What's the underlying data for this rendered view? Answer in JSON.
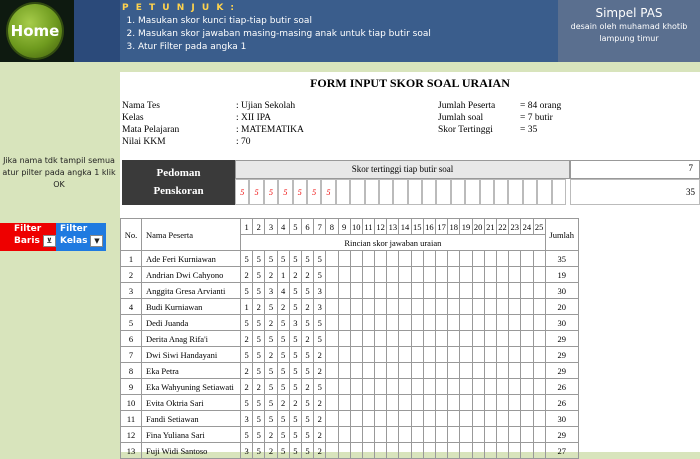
{
  "header": {
    "home_label": "Home",
    "instructions_title": "P E T U N J U K :",
    "instructions": [
      "Masukan skor kunci tiap-tiap butir soal",
      "Masukan skor jawaban masing-masing anak untuk tiap butir soal",
      "Atur Filter pada angka 1"
    ],
    "brand_title": "Simpel PAS",
    "brand_sub1": "desain oleh muhamad khotib",
    "brand_sub2": "lampung timur"
  },
  "sidebar": {
    "note": "Jika nama tdk tampil semua atur pilter pada angka 1 klik OK",
    "filter_baris_l1": "Filter",
    "filter_baris_l2": "Baris",
    "filter_kelas_l1": "Filter",
    "filter_kelas_l2": "Kelas"
  },
  "form": {
    "title": "FORM INPUT SKOR SOAL URAIAN",
    "left": [
      {
        "k": "Nama Tes",
        "v": ":  Ujian Sekolah"
      },
      {
        "k": "Kelas",
        "v": ":  XII IPA"
      },
      {
        "k": "Mata Pelajaran",
        "v": ":  MATEMATIKA"
      },
      {
        "k": "Nilai KKM",
        "v": ":  70"
      }
    ],
    "right": [
      {
        "k": "Jumlah Peserta",
        "v": "=   84 orang"
      },
      {
        "k": "Jumlah soal",
        "v": "=   7 butir"
      },
      {
        "k": "Skor Tertinggi",
        "v": "=   35"
      }
    ],
    "pedoman_l1": "Pedoman",
    "pedoman_l2": "Penskoran",
    "skor_header": "Skor tertinggi tiap butir soal",
    "max_scores": [
      "5",
      "5",
      "5",
      "5",
      "5",
      "5",
      "5"
    ],
    "soal_count": "7",
    "total_max": "35"
  },
  "table": {
    "col_no": "No.",
    "col_name": "Nama Peserta",
    "col_total": "Jumlah",
    "sub_header": "Rincian skor jawaban uraian",
    "item_numbers": [
      "1",
      "2",
      "3",
      "4",
      "5",
      "6",
      "7",
      "8",
      "9",
      "10",
      "11",
      "12",
      "13",
      "14",
      "15",
      "16",
      "17",
      "18",
      "19",
      "20",
      "21",
      "22",
      "23",
      "24",
      "25"
    ],
    "rows": [
      {
        "no": "1",
        "name": "Ade Feri Kurniawan",
        "s": [
          "5",
          "5",
          "5",
          "5",
          "5",
          "5",
          "5"
        ],
        "total": "35"
      },
      {
        "no": "2",
        "name": "Andrian Dwi Cahyono",
        "s": [
          "2",
          "5",
          "2",
          "1",
          "2",
          "2",
          "5"
        ],
        "total": "19"
      },
      {
        "no": "3",
        "name": "Anggita Gresa Arvianti",
        "s": [
          "5",
          "5",
          "3",
          "4",
          "5",
          "5",
          "3"
        ],
        "total": "30"
      },
      {
        "no": "4",
        "name": "Budi Kurniawan",
        "s": [
          "1",
          "2",
          "5",
          "2",
          "5",
          "2",
          "3"
        ],
        "total": "20"
      },
      {
        "no": "5",
        "name": "Dedi Juanda",
        "s": [
          "5",
          "5",
          "2",
          "5",
          "3",
          "5",
          "5"
        ],
        "total": "30"
      },
      {
        "no": "6",
        "name": "Derita Anag Rifa'i",
        "s": [
          "2",
          "5",
          "5",
          "5",
          "5",
          "2",
          "5"
        ],
        "total": "29"
      },
      {
        "no": "7",
        "name": "Dwi Siwi Handayani",
        "s": [
          "5",
          "5",
          "2",
          "5",
          "5",
          "5",
          "2"
        ],
        "total": "29"
      },
      {
        "no": "8",
        "name": "Eka Petra",
        "s": [
          "2",
          "5",
          "5",
          "5",
          "5",
          "5",
          "2"
        ],
        "total": "29"
      },
      {
        "no": "9",
        "name": "Eka Wahyuning Setiawati",
        "s": [
          "2",
          "2",
          "5",
          "5",
          "5",
          "2",
          "5"
        ],
        "total": "26"
      },
      {
        "no": "10",
        "name": "Evita Oktria Sari",
        "s": [
          "5",
          "5",
          "5",
          "2",
          "2",
          "5",
          "2"
        ],
        "total": "26"
      },
      {
        "no": "11",
        "name": "Fandi Setiawan",
        "s": [
          "3",
          "5",
          "5",
          "5",
          "5",
          "5",
          "2"
        ],
        "total": "30"
      },
      {
        "no": "12",
        "name": "Fina Yuliana Sari",
        "s": [
          "5",
          "5",
          "2",
          "5",
          "5",
          "5",
          "2"
        ],
        "total": "29"
      },
      {
        "no": "13",
        "name": "Fuji Widi Santoso",
        "s": [
          "3",
          "5",
          "2",
          "5",
          "5",
          "5",
          "2"
        ],
        "total": "27"
      }
    ]
  }
}
